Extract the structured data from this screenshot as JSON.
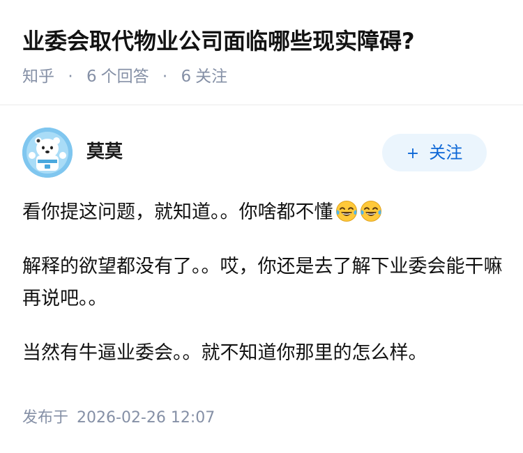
{
  "question": {
    "title": "业委会取代物业公司面临哪些现实障碍?",
    "source": "知乎",
    "separator": "·",
    "answer_count": "6",
    "answer_label": "个回答",
    "follower_count": "6",
    "follower_label": "关注"
  },
  "author": {
    "name": "莫莫",
    "avatar_icon": "avatar-cartoon-bear-icon",
    "follow_plus": "+",
    "follow_label": "关注"
  },
  "answer": {
    "paragraph_1": "看你提这问题，就知道。。你啥都不懂",
    "emoji_icon": "tears-of-joy-emoji-icon",
    "paragraph_2": "解释的欲望都没有了。。哎，你还是去了解下业委会能干嘛再说吧。。",
    "paragraph_3": "当然有牛逼业委会。。就不知道你那里的怎么样。"
  },
  "footer": {
    "published_label": "发布于",
    "published_time": "2026-02-26 12:07"
  },
  "colors": {
    "accent": "#0b66d6",
    "accent_bg": "#ebf5fd",
    "meta_gray": "#8590a6",
    "avatar_bg": "#7fc6ef"
  }
}
